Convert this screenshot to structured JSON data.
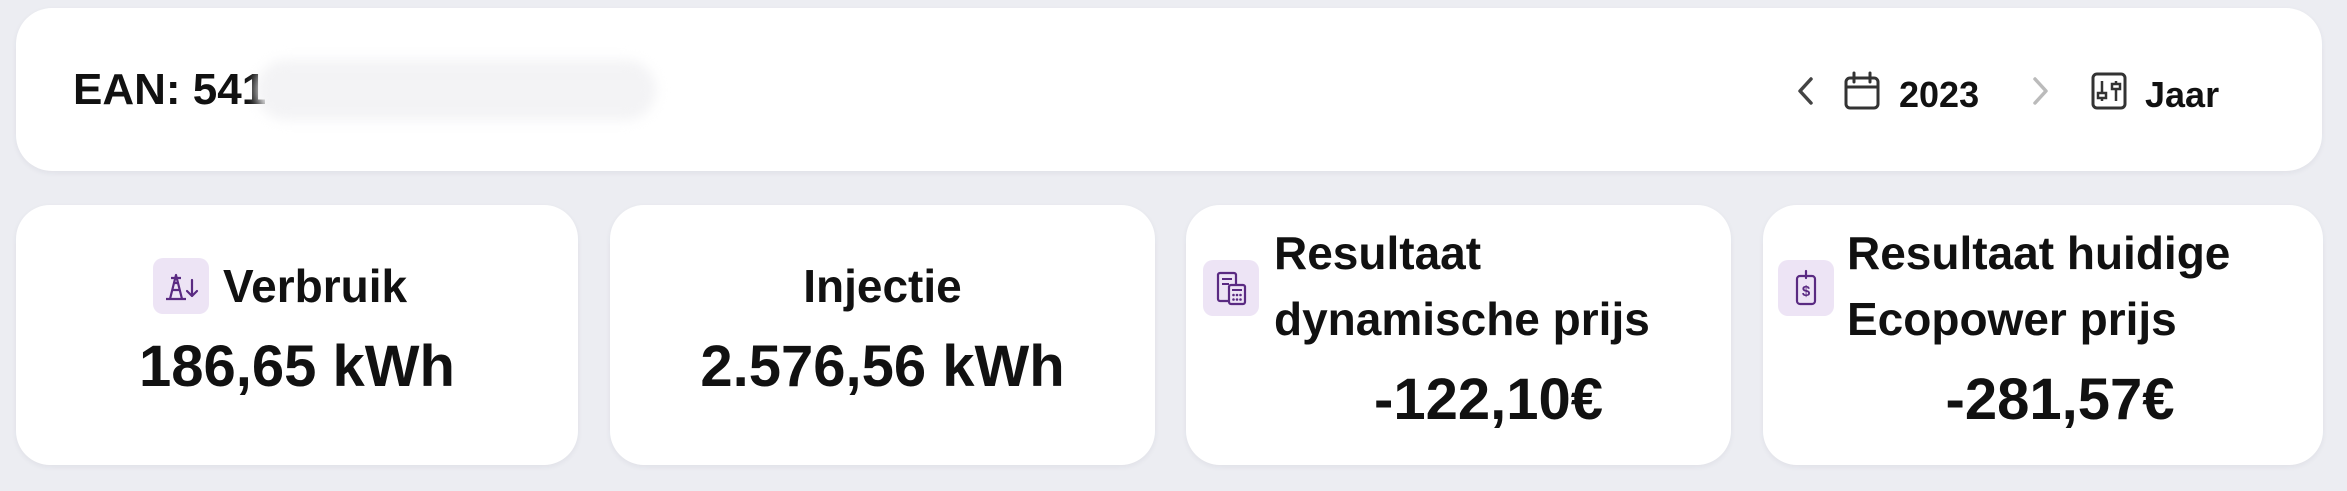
{
  "header": {
    "ean_label": "EAN: 541",
    "year": "2023",
    "period": "Jaar",
    "icons": {
      "prev": "chevron-left-icon",
      "calendar": "calendar-icon",
      "next": "chevron-right-icon",
      "filter": "sliders-icon"
    }
  },
  "cards": {
    "verbruik": {
      "title": "Verbruik",
      "value": "186,65 kWh",
      "icon": "power-pylon-down-icon"
    },
    "injectie": {
      "title": "Injectie",
      "value": "2.576,56 kWh"
    },
    "dynamisch": {
      "title_line1": "Resultaat",
      "title_line2": "dynamische prijs",
      "value": "-122,10€",
      "icon": "invoice-calculator-icon"
    },
    "ecopower": {
      "title_line1": "Resultaat huidige",
      "title_line2": "Ecopower prijs",
      "value": "-281,57€",
      "icon": "dollar-tag-icon"
    }
  },
  "colors": {
    "page_background": "#ecedf2",
    "card_background": "#ffffff",
    "icon_tile": "#ede4f5",
    "icon_stroke": "#5a2a82",
    "text": "#111111"
  }
}
